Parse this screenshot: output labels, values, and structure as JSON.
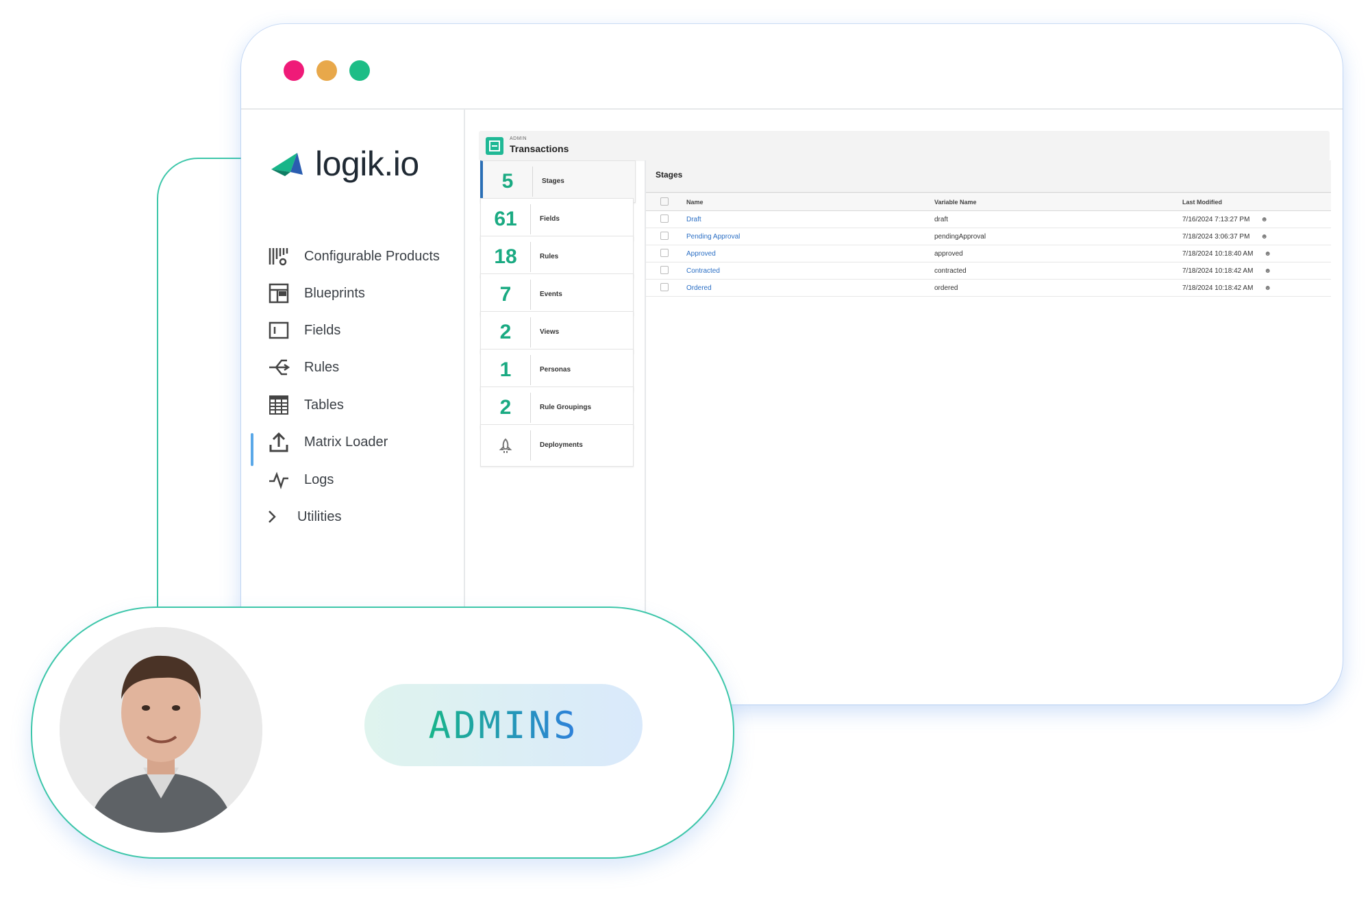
{
  "window": {
    "traffic_lights": {
      "red": "#ef1a78",
      "yellow": "#e8a84a",
      "green": "#1dbd86"
    }
  },
  "brand": {
    "logo_text": "logik.io",
    "accent": "#1aaa82",
    "link": "#2a6ec4"
  },
  "sidebar": {
    "items": [
      {
        "label": "Configurable Products",
        "icon": "configurable-products-icon"
      },
      {
        "label": "Blueprints",
        "icon": "blueprint-icon"
      },
      {
        "label": "Fields",
        "icon": "field-icon",
        "active": true
      },
      {
        "label": "Rules",
        "icon": "rules-branch-icon"
      },
      {
        "label": "Tables",
        "icon": "table-icon"
      },
      {
        "label": "Matrix Loader",
        "icon": "upload-icon"
      },
      {
        "label": "Logs",
        "icon": "pulse-icon"
      },
      {
        "label": "Utilities",
        "icon": "chevron-right-icon"
      }
    ]
  },
  "header": {
    "subtitle": "ADMIN",
    "title": "Transactions"
  },
  "cards": [
    {
      "count": "5",
      "label": "Stages",
      "active": true
    },
    {
      "count": "61",
      "label": "Fields"
    },
    {
      "count": "18",
      "label": "Rules"
    },
    {
      "count": "7",
      "label": "Events"
    },
    {
      "count": "2",
      "label": "Views"
    },
    {
      "count": "1",
      "label": "Personas"
    },
    {
      "count": "2",
      "label": "Rule Groupings"
    },
    {
      "count": "",
      "label": "Deployments",
      "icon": "rocket-icon"
    }
  ],
  "stages_panel": {
    "title": "Stages",
    "columns": [
      "Name",
      "Variable Name",
      "Last Modified"
    ],
    "rows": [
      {
        "name": "Draft",
        "variable": "draft",
        "modified": "7/16/2024 7:13:27 PM"
      },
      {
        "name": "Pending Approval",
        "variable": "pendingApproval",
        "modified": "7/18/2024 3:06:37 PM"
      },
      {
        "name": "Approved",
        "variable": "approved",
        "modified": "7/18/2024 10:18:40 AM"
      },
      {
        "name": "Contracted",
        "variable": "contracted",
        "modified": "7/18/2024 10:18:42 AM"
      },
      {
        "name": "Ordered",
        "variable": "ordered",
        "modified": "7/18/2024 10:18:42 AM"
      }
    ]
  },
  "persona": {
    "role": "ADMINS"
  }
}
